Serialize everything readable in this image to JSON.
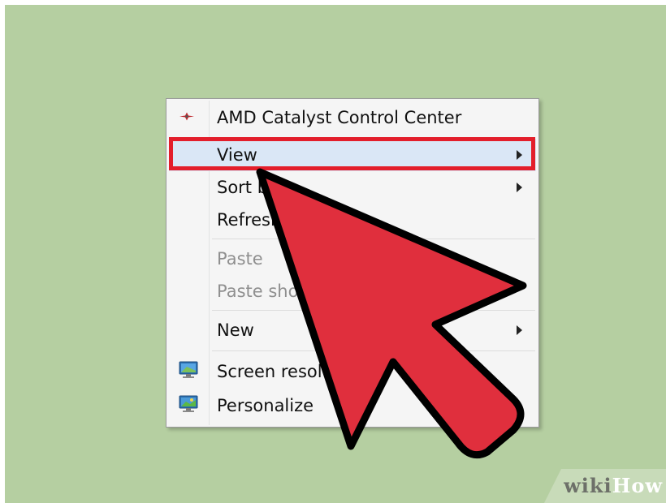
{
  "context_menu": {
    "items": [
      {
        "label": "AMD Catalyst Control Center",
        "icon": "amd-catalyst-icon",
        "submenu": false,
        "disabled": false
      },
      {
        "label": "View",
        "submenu": true,
        "disabled": false,
        "selected": true,
        "highlighted": true
      },
      {
        "label": "Sort b",
        "submenu": true,
        "disabled": false
      },
      {
        "label": "Refresl",
        "submenu": false,
        "disabled": false
      },
      {
        "label": "Paste",
        "submenu": false,
        "disabled": true
      },
      {
        "label": "Paste sho",
        "submenu": false,
        "disabled": true
      },
      {
        "label": "New",
        "submenu": true,
        "disabled": false
      },
      {
        "label": "Screen resolu",
        "icon": "screen-resolution-icon",
        "submenu": false,
        "disabled": false
      },
      {
        "label": "Personalize",
        "icon": "personalize-icon",
        "submenu": false,
        "disabled": false
      }
    ]
  },
  "overlay": {
    "cursor": "red-arrow-cursor-icon",
    "cursor_color": "#e02f3d",
    "highlight_color": "#e31e2b"
  },
  "watermark": {
    "part1": "wiki",
    "part2": "How"
  },
  "colors": {
    "desktop_background": "#b5cfa1",
    "menu_background": "#f5f5f5",
    "selected_background": "#dae7f6"
  }
}
